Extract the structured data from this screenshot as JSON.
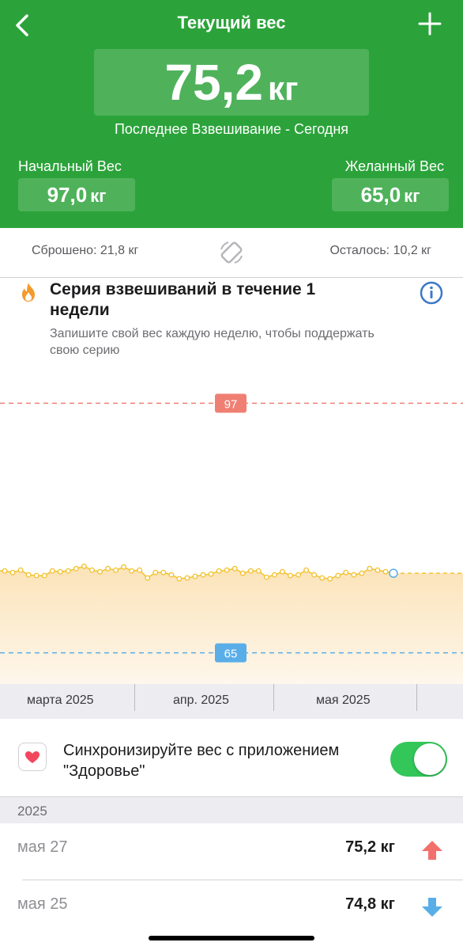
{
  "header": {
    "title": "Текущий вес",
    "current_weight": "75,2",
    "unit": "кг",
    "last_weighing": "Последнее Взвешивание - Сегодня",
    "start_label": "Начальный Вес",
    "start_value": "97,0",
    "goal_label": "Желанный Вес",
    "goal_value": "65,0"
  },
  "stats": {
    "lost": "Сброшено: 21,8 кг",
    "remaining": "Осталось: 10,2 кг"
  },
  "streak": {
    "title": "Серия взвешиваний в течение 1 недели",
    "subtitle": "Запишите свой вес каждую неделю, чтобы поддержать свою серию"
  },
  "chart_data": {
    "type": "line",
    "start_line": 97,
    "goal_line": 65,
    "x_labels": [
      "марта 2025",
      "апр. 2025",
      "мая 2025"
    ],
    "ylim": [
      61,
      101
    ],
    "values": [
      75.5,
      75.3,
      75.6,
      75.0,
      74.9,
      74.9,
      75.5,
      75.4,
      75.5,
      75.8,
      76.1,
      75.6,
      75.4,
      75.8,
      75.6,
      76.0,
      75.5,
      75.6,
      74.6,
      75.3,
      75.3,
      75.0,
      74.5,
      74.6,
      74.8,
      75.0,
      75.1,
      75.5,
      75.6,
      75.8,
      75.2,
      75.5,
      75.5,
      74.7,
      75.0,
      75.4,
      74.9,
      75.0,
      75.6,
      75.0,
      74.6,
      74.5,
      74.9,
      75.3,
      75.0,
      75.2,
      75.8,
      75.6,
      75.4,
      75.2
    ],
    "highlight_value": 75.2,
    "color_line": "#f2c12e",
    "color_start": "#f07f73",
    "color_goal": "#5aaee8"
  },
  "sync": {
    "text": "Синхронизируйте вес с приложением \"Здоровье\"",
    "enabled": true
  },
  "history": {
    "year": "2025",
    "entries": [
      {
        "date": "мая 27",
        "weight": "75,2 кг",
        "trend": "up"
      },
      {
        "date": "мая 25",
        "weight": "74,8 кг",
        "trend": "down"
      }
    ]
  },
  "colors": {
    "header_green": "#2ba33a",
    "box_green": "#4fb25b",
    "toggle_green": "#33c759",
    "arrow_up": "#f2706c",
    "arrow_down": "#5aaee8"
  }
}
